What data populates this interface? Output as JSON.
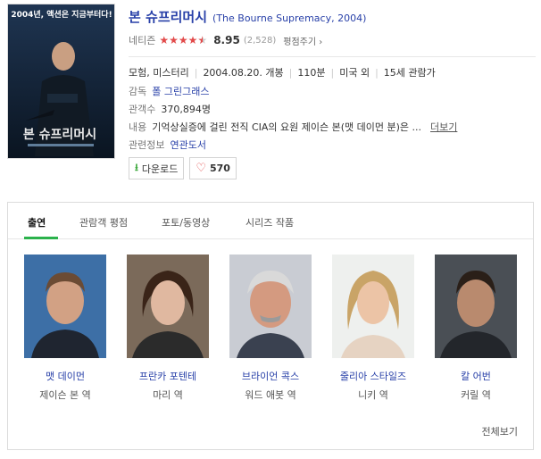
{
  "movie": {
    "poster_tagline": "2004년, 액션은 지금부터다!",
    "poster_title": "본 슈프리머시",
    "title": "본 슈프리머시",
    "original_title": "(The Bourne Supremacy, 2004)",
    "netizen_label": "네티즌",
    "rating": {
      "stars_out_of_5": 4.5,
      "score": "8.95",
      "count": "(2,528)",
      "rate_label": "평점주기"
    },
    "genre": "모험, 미스터리",
    "release": "2004.08.20. 개봉",
    "runtime": "110분",
    "country": "미국 외",
    "age": "15세 관람가",
    "director_label": "감독",
    "director": "폴 그린그래스",
    "audience_label": "관객수",
    "audience": "370,894명",
    "content_label": "내용",
    "content": "기억상실증에 걸린 전직 CIA의 요원 제이슨 본(맷 데이먼 분)은 ...",
    "more_label": "더보기",
    "related_label": "관련정보",
    "related": "연관도서",
    "download_label": "다운로드",
    "like_count": "570"
  },
  "tabs": [
    "출연",
    "관람객 평점",
    "포토/동영상",
    "시리즈 작품"
  ],
  "cast": [
    {
      "name": "맷 데이먼",
      "role": "제이슨 본 역"
    },
    {
      "name": "프란카 포텐테",
      "role": "마리 역"
    },
    {
      "name": "브라이언 콕스",
      "role": "워드 애봇 역"
    },
    {
      "name": "줄리아 스타일즈",
      "role": "니키 역"
    },
    {
      "name": "칼 어번",
      "role": "커릴 역"
    }
  ],
  "view_all_label": "전체보기",
  "colors": {
    "link_blue": "#2840a8",
    "star_red": "#e24a4a",
    "tab_green": "#2bb24c"
  },
  "icons": {
    "download": "download-arrow-icon",
    "like": "heart-icon"
  }
}
